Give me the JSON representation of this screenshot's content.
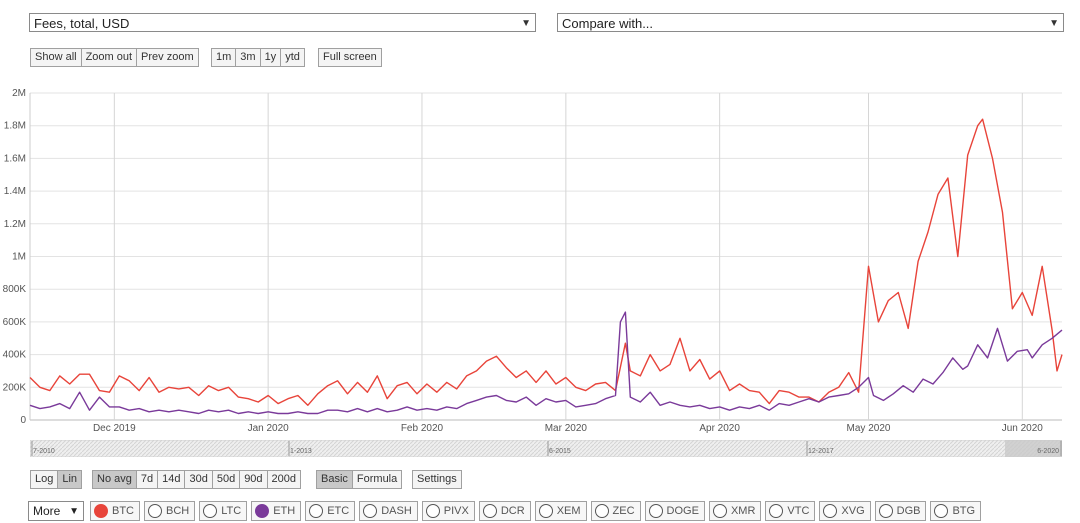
{
  "controls": {
    "metric_select": "Fees, total, USD",
    "compare_select": "Compare with...",
    "zoom_buttons": [
      "Show all",
      "Zoom out",
      "Prev zoom"
    ],
    "range_buttons": [
      "1m",
      "3m",
      "1y",
      "ytd"
    ],
    "fullscreen": "Full screen",
    "scale_buttons": [
      "Log",
      "Lin"
    ],
    "avg_buttons": [
      "No avg",
      "7d",
      "14d",
      "30d",
      "50d",
      "90d",
      "200d"
    ],
    "mode_buttons": [
      "Basic",
      "Formula"
    ],
    "settings": "Settings",
    "more_select": "More"
  },
  "coins": [
    {
      "label": "BTC",
      "color": "#e8443a",
      "selected": true
    },
    {
      "label": "BCH",
      "selected": false
    },
    {
      "label": "LTC",
      "selected": false
    },
    {
      "label": "ETH",
      "color": "#7a3a9a",
      "selected": true
    },
    {
      "label": "ETC",
      "selected": false
    },
    {
      "label": "DASH",
      "selected": false
    },
    {
      "label": "PIVX",
      "selected": false
    },
    {
      "label": "DCR",
      "selected": false
    },
    {
      "label": "XEM",
      "selected": false
    },
    {
      "label": "ZEC",
      "selected": false
    },
    {
      "label": "DOGE",
      "selected": false
    },
    {
      "label": "XMR",
      "selected": false
    },
    {
      "label": "VTC",
      "selected": false
    },
    {
      "label": "XVG",
      "selected": false
    },
    {
      "label": "DGB",
      "selected": false
    },
    {
      "label": "BTG",
      "selected": false
    }
  ],
  "navigator_labels": [
    "7-2010",
    "1-2013",
    "6-2015",
    "12-2017",
    "6-2020"
  ],
  "chart_data": {
    "type": "line",
    "x_start": "2019-11-14",
    "x_end": "2020-06-09",
    "ylim": [
      0,
      2000000
    ],
    "y_ticks": [
      0,
      200000,
      400000,
      600000,
      800000,
      1000000,
      1200000,
      1400000,
      1600000,
      1800000,
      2000000
    ],
    "y_tick_labels": [
      "0",
      "200K",
      "400K",
      "600K",
      "800K",
      "1M",
      "1.2M",
      "1.4M",
      "1.6M",
      "1.8M",
      "2M"
    ],
    "x_ticks": [
      {
        "date": "2019-12-01",
        "label": "Dec 2019"
      },
      {
        "date": "2020-01-01",
        "label": "Jan 2020"
      },
      {
        "date": "2020-02-01",
        "label": "Feb 2020"
      },
      {
        "date": "2020-03-01",
        "label": "Mar 2020"
      },
      {
        "date": "2020-04-01",
        "label": "Apr 2020"
      },
      {
        "date": "2020-05-01",
        "label": "May 2020"
      },
      {
        "date": "2020-06-01",
        "label": "Jun 2020"
      }
    ],
    "grid": true,
    "series": [
      {
        "name": "BTC",
        "color": "#e8443a",
        "points": [
          [
            "2019-11-14",
            260000
          ],
          [
            "2019-11-16",
            200000
          ],
          [
            "2019-11-18",
            180000
          ],
          [
            "2019-11-20",
            270000
          ],
          [
            "2019-11-22",
            220000
          ],
          [
            "2019-11-24",
            280000
          ],
          [
            "2019-11-26",
            280000
          ],
          [
            "2019-11-28",
            180000
          ],
          [
            "2019-11-30",
            170000
          ],
          [
            "2019-12-02",
            270000
          ],
          [
            "2019-12-04",
            240000
          ],
          [
            "2019-12-06",
            180000
          ],
          [
            "2019-12-08",
            260000
          ],
          [
            "2019-12-10",
            170000
          ],
          [
            "2019-12-12",
            200000
          ],
          [
            "2019-12-14",
            190000
          ],
          [
            "2019-12-16",
            200000
          ],
          [
            "2019-12-18",
            150000
          ],
          [
            "2019-12-20",
            210000
          ],
          [
            "2019-12-22",
            180000
          ],
          [
            "2019-12-24",
            200000
          ],
          [
            "2019-12-26",
            140000
          ],
          [
            "2019-12-28",
            130000
          ],
          [
            "2019-12-30",
            110000
          ],
          [
            "2020-01-01",
            150000
          ],
          [
            "2020-01-03",
            100000
          ],
          [
            "2020-01-05",
            130000
          ],
          [
            "2020-01-07",
            150000
          ],
          [
            "2020-01-09",
            90000
          ],
          [
            "2020-01-11",
            160000
          ],
          [
            "2020-01-13",
            210000
          ],
          [
            "2020-01-15",
            240000
          ],
          [
            "2020-01-17",
            160000
          ],
          [
            "2020-01-19",
            230000
          ],
          [
            "2020-01-21",
            170000
          ],
          [
            "2020-01-23",
            270000
          ],
          [
            "2020-01-25",
            130000
          ],
          [
            "2020-01-27",
            210000
          ],
          [
            "2020-01-29",
            230000
          ],
          [
            "2020-01-31",
            160000
          ],
          [
            "2020-02-02",
            220000
          ],
          [
            "2020-02-04",
            170000
          ],
          [
            "2020-02-06",
            230000
          ],
          [
            "2020-02-08",
            190000
          ],
          [
            "2020-02-10",
            270000
          ],
          [
            "2020-02-12",
            300000
          ],
          [
            "2020-02-14",
            360000
          ],
          [
            "2020-02-16",
            390000
          ],
          [
            "2020-02-18",
            320000
          ],
          [
            "2020-02-20",
            260000
          ],
          [
            "2020-02-22",
            300000
          ],
          [
            "2020-02-24",
            230000
          ],
          [
            "2020-02-26",
            300000
          ],
          [
            "2020-02-28",
            220000
          ],
          [
            "2020-03-01",
            260000
          ],
          [
            "2020-03-03",
            200000
          ],
          [
            "2020-03-05",
            180000
          ],
          [
            "2020-03-07",
            220000
          ],
          [
            "2020-03-09",
            230000
          ],
          [
            "2020-03-11",
            180000
          ],
          [
            "2020-03-13",
            470000
          ],
          [
            "2020-03-14",
            300000
          ],
          [
            "2020-03-16",
            270000
          ],
          [
            "2020-03-18",
            400000
          ],
          [
            "2020-03-20",
            300000
          ],
          [
            "2020-03-22",
            340000
          ],
          [
            "2020-03-24",
            500000
          ],
          [
            "2020-03-26",
            300000
          ],
          [
            "2020-03-28",
            370000
          ],
          [
            "2020-03-30",
            250000
          ],
          [
            "2020-04-01",
            300000
          ],
          [
            "2020-04-03",
            180000
          ],
          [
            "2020-04-05",
            220000
          ],
          [
            "2020-04-07",
            180000
          ],
          [
            "2020-04-09",
            170000
          ],
          [
            "2020-04-11",
            100000
          ],
          [
            "2020-04-13",
            180000
          ],
          [
            "2020-04-15",
            170000
          ],
          [
            "2020-04-17",
            140000
          ],
          [
            "2020-04-19",
            140000
          ],
          [
            "2020-04-21",
            110000
          ],
          [
            "2020-04-23",
            170000
          ],
          [
            "2020-04-25",
            200000
          ],
          [
            "2020-04-27",
            290000
          ],
          [
            "2020-04-29",
            170000
          ],
          [
            "2020-05-01",
            940000
          ],
          [
            "2020-05-03",
            600000
          ],
          [
            "2020-05-05",
            730000
          ],
          [
            "2020-05-07",
            780000
          ],
          [
            "2020-05-09",
            560000
          ],
          [
            "2020-05-11",
            970000
          ],
          [
            "2020-05-13",
            1150000
          ],
          [
            "2020-05-15",
            1380000
          ],
          [
            "2020-05-17",
            1480000
          ],
          [
            "2020-05-19",
            1000000
          ],
          [
            "2020-05-21",
            1620000
          ],
          [
            "2020-05-23",
            1800000
          ],
          [
            "2020-05-24",
            1840000
          ],
          [
            "2020-05-26",
            1600000
          ],
          [
            "2020-05-28",
            1270000
          ],
          [
            "2020-05-30",
            680000
          ],
          [
            "2020-06-01",
            780000
          ],
          [
            "2020-06-03",
            640000
          ],
          [
            "2020-06-05",
            940000
          ],
          [
            "2020-06-07",
            550000
          ],
          [
            "2020-06-08",
            300000
          ],
          [
            "2020-06-09",
            400000
          ]
        ]
      },
      {
        "name": "ETH",
        "color": "#7a3a9a",
        "points": [
          [
            "2019-11-14",
            90000
          ],
          [
            "2019-11-16",
            70000
          ],
          [
            "2019-11-18",
            80000
          ],
          [
            "2019-11-20",
            100000
          ],
          [
            "2019-11-22",
            70000
          ],
          [
            "2019-11-24",
            170000
          ],
          [
            "2019-11-26",
            60000
          ],
          [
            "2019-11-28",
            140000
          ],
          [
            "2019-11-30",
            80000
          ],
          [
            "2019-12-02",
            80000
          ],
          [
            "2019-12-04",
            60000
          ],
          [
            "2019-12-06",
            70000
          ],
          [
            "2019-12-08",
            50000
          ],
          [
            "2019-12-10",
            60000
          ],
          [
            "2019-12-12",
            50000
          ],
          [
            "2019-12-14",
            60000
          ],
          [
            "2019-12-16",
            50000
          ],
          [
            "2019-12-18",
            40000
          ],
          [
            "2019-12-20",
            60000
          ],
          [
            "2019-12-22",
            50000
          ],
          [
            "2019-12-24",
            60000
          ],
          [
            "2019-12-26",
            40000
          ],
          [
            "2019-12-28",
            50000
          ],
          [
            "2019-12-30",
            40000
          ],
          [
            "2020-01-01",
            50000
          ],
          [
            "2020-01-03",
            40000
          ],
          [
            "2020-01-05",
            40000
          ],
          [
            "2020-01-07",
            50000
          ],
          [
            "2020-01-09",
            40000
          ],
          [
            "2020-01-11",
            40000
          ],
          [
            "2020-01-13",
            60000
          ],
          [
            "2020-01-15",
            60000
          ],
          [
            "2020-01-17",
            50000
          ],
          [
            "2020-01-19",
            70000
          ],
          [
            "2020-01-21",
            50000
          ],
          [
            "2020-01-23",
            70000
          ],
          [
            "2020-01-25",
            50000
          ],
          [
            "2020-01-27",
            60000
          ],
          [
            "2020-01-29",
            80000
          ],
          [
            "2020-01-31",
            60000
          ],
          [
            "2020-02-02",
            70000
          ],
          [
            "2020-02-04",
            60000
          ],
          [
            "2020-02-06",
            80000
          ],
          [
            "2020-02-08",
            70000
          ],
          [
            "2020-02-10",
            100000
          ],
          [
            "2020-02-12",
            120000
          ],
          [
            "2020-02-14",
            140000
          ],
          [
            "2020-02-16",
            150000
          ],
          [
            "2020-02-18",
            120000
          ],
          [
            "2020-02-20",
            110000
          ],
          [
            "2020-02-22",
            140000
          ],
          [
            "2020-02-24",
            90000
          ],
          [
            "2020-02-26",
            130000
          ],
          [
            "2020-02-28",
            110000
          ],
          [
            "2020-03-01",
            120000
          ],
          [
            "2020-03-03",
            80000
          ],
          [
            "2020-03-05",
            90000
          ],
          [
            "2020-03-07",
            100000
          ],
          [
            "2020-03-09",
            130000
          ],
          [
            "2020-03-11",
            150000
          ],
          [
            "2020-03-12",
            600000
          ],
          [
            "2020-03-13",
            660000
          ],
          [
            "2020-03-14",
            140000
          ],
          [
            "2020-03-16",
            110000
          ],
          [
            "2020-03-18",
            170000
          ],
          [
            "2020-03-20",
            90000
          ],
          [
            "2020-03-22",
            110000
          ],
          [
            "2020-03-24",
            90000
          ],
          [
            "2020-03-26",
            80000
          ],
          [
            "2020-03-28",
            90000
          ],
          [
            "2020-03-30",
            70000
          ],
          [
            "2020-04-01",
            80000
          ],
          [
            "2020-04-03",
            60000
          ],
          [
            "2020-04-05",
            80000
          ],
          [
            "2020-04-07",
            70000
          ],
          [
            "2020-04-09",
            90000
          ],
          [
            "2020-04-11",
            60000
          ],
          [
            "2020-04-13",
            100000
          ],
          [
            "2020-04-15",
            90000
          ],
          [
            "2020-04-17",
            110000
          ],
          [
            "2020-04-19",
            130000
          ],
          [
            "2020-04-21",
            110000
          ],
          [
            "2020-04-23",
            140000
          ],
          [
            "2020-04-25",
            150000
          ],
          [
            "2020-04-27",
            160000
          ],
          [
            "2020-04-29",
            200000
          ],
          [
            "2020-05-01",
            260000
          ],
          [
            "2020-05-02",
            150000
          ],
          [
            "2020-05-04",
            120000
          ],
          [
            "2020-05-06",
            160000
          ],
          [
            "2020-05-08",
            210000
          ],
          [
            "2020-05-10",
            170000
          ],
          [
            "2020-05-12",
            250000
          ],
          [
            "2020-05-14",
            220000
          ],
          [
            "2020-05-16",
            290000
          ],
          [
            "2020-05-18",
            380000
          ],
          [
            "2020-05-20",
            310000
          ],
          [
            "2020-05-21",
            330000
          ],
          [
            "2020-05-23",
            460000
          ],
          [
            "2020-05-25",
            380000
          ],
          [
            "2020-05-27",
            560000
          ],
          [
            "2020-05-29",
            360000
          ],
          [
            "2020-05-31",
            420000
          ],
          [
            "2020-06-02",
            430000
          ],
          [
            "2020-06-03",
            380000
          ],
          [
            "2020-06-05",
            460000
          ],
          [
            "2020-06-07",
            500000
          ],
          [
            "2020-06-09",
            550000
          ]
        ]
      }
    ]
  }
}
